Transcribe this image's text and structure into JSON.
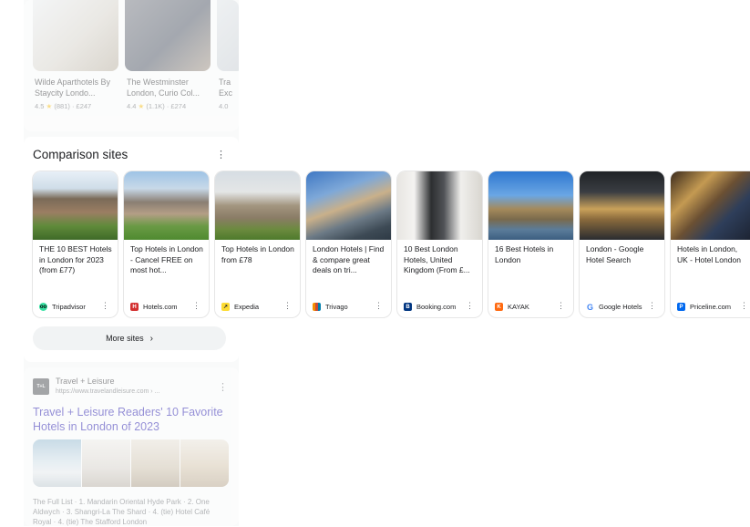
{
  "top_hotels": [
    {
      "name": "Wilde Aparthotels By Staycity Londo...",
      "rating": "4.5",
      "reviews": "(881)",
      "price": "£247"
    },
    {
      "name": "The Westminster London, Curio Col...",
      "rating": "4.4",
      "reviews": "(1.1K)",
      "price": "£274"
    },
    {
      "name": "Tra\nExc",
      "rating": "4.0",
      "reviews": "",
      "price": ""
    }
  ],
  "comparison": {
    "title": "Comparison sites",
    "more_label": "More sites",
    "sites": [
      {
        "title": "THE 10 BEST Hotels in London for 2023 (from £77)",
        "source": "Tripadvisor",
        "logo_color": "#34e0a1",
        "logo_icon": "owl-eyes-icon"
      },
      {
        "title": "Top Hotels in London - Cancel FREE on most hot...",
        "source": "Hotels.com",
        "logo_color": "#d32f2f",
        "logo_icon": "hotels-h-icon"
      },
      {
        "title": "Top Hotels in London from £78",
        "source": "Expedia",
        "logo_color": "#fddb32",
        "logo_icon": "expedia-arrow-icon"
      },
      {
        "title": "London Hotels | Find & compare great deals on tri...",
        "source": "Trivago",
        "logo_color": "#f48f00",
        "logo_icon": "trivago-bars-icon"
      },
      {
        "title": "10 Best London Hotels, United Kingdom (From £...",
        "source": "Booking.com",
        "logo_color": "#003580",
        "logo_icon": "booking-b-icon"
      },
      {
        "title": "16 Best Hotels in London",
        "source": "KAYAK",
        "logo_color": "#ff690f",
        "logo_icon": "kayak-k-icon"
      },
      {
        "title": "London - Google Hotel Search",
        "source": "Google Hotels",
        "logo_color": "#4285f4",
        "logo_icon": "google-g-icon"
      },
      {
        "title": "Hotels in London, UK - Hotel London",
        "source": "Priceline.com",
        "logo_color": "#0068ef",
        "logo_icon": "priceline-p-icon"
      }
    ]
  },
  "result": {
    "site_name": "Travel + Leisure",
    "url": "https://www.travelandleisure.com › ...",
    "logo_text": "T+L",
    "headline": "Travel + Leisure Readers' 10 Favorite Hotels in London of 2023",
    "snippet": "The Full List · 1. Mandarin Oriental Hyde Park · 2. One Aldwych · 3. Shangri-La The Shard · 4. (tie) Hotel Café Royal · 4. (tie) The Stafford London"
  },
  "colors": {
    "link": "#1a0dab",
    "star": "#fbbc04"
  }
}
